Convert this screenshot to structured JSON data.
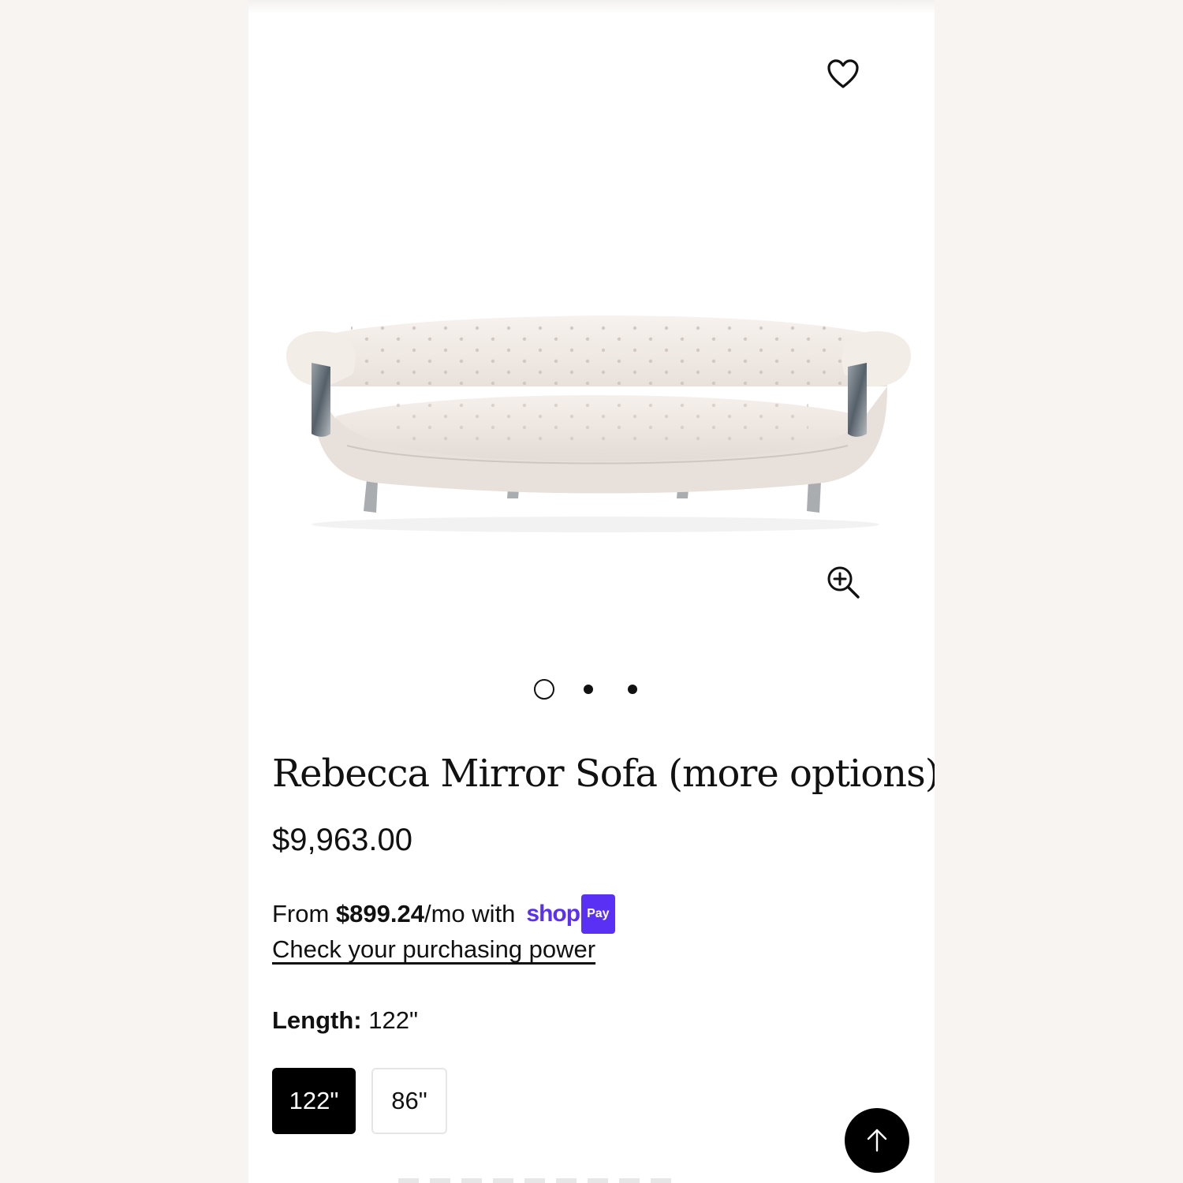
{
  "product": {
    "title": "Rebecca Mirror Sofa (more options)",
    "price": "$9,963.00",
    "image_count": 3,
    "active_image_index": 0
  },
  "financing": {
    "prefix": "From ",
    "amount": "$899.24",
    "suffix": "/mo with",
    "provider_wordmark": "shop",
    "provider_badge": "Pay",
    "link_label": "Check your purchasing power"
  },
  "options": {
    "label": "Length:",
    "selected_value": "122\"",
    "values": [
      "122\"",
      "86\""
    ]
  },
  "icons": {
    "favorite": "heart-icon",
    "zoom": "zoom-in-icon",
    "back_to_top": "arrow-up-icon"
  },
  "colors": {
    "shop_pay": "#5a31f4",
    "selected_swatch": "#000000",
    "page_background": "#f7f4f1"
  }
}
